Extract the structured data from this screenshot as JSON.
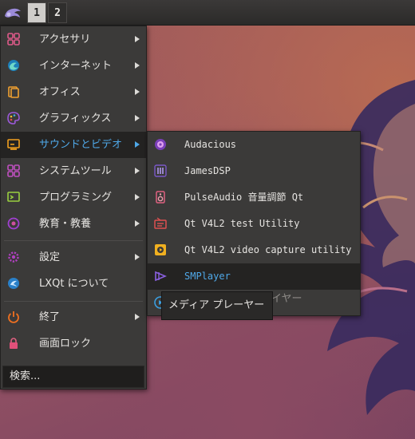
{
  "panel": {
    "desktops": [
      "1",
      "2"
    ],
    "active_desktop": "1"
  },
  "main_menu": {
    "items": [
      {
        "label": "アクセサリ",
        "icon": "accessories-icon",
        "submenu": true
      },
      {
        "label": "インターネット",
        "icon": "internet-icon",
        "submenu": true
      },
      {
        "label": "オフィス",
        "icon": "office-icon",
        "submenu": true
      },
      {
        "label": "グラフィックス",
        "icon": "graphics-icon",
        "submenu": true
      },
      {
        "label": "サウンドとビデオ",
        "icon": "sound-video-icon",
        "submenu": true,
        "selected": true
      },
      {
        "label": "システムツール",
        "icon": "system-tools-icon",
        "submenu": true
      },
      {
        "label": "プログラミング",
        "icon": "programming-icon",
        "submenu": true
      },
      {
        "label": "教育・教養",
        "icon": "education-icon",
        "submenu": true
      },
      {
        "label": "設定",
        "icon": "settings-icon",
        "submenu": true
      },
      {
        "label": "LXQt について",
        "icon": "lxqt-about-icon",
        "submenu": false
      },
      {
        "label": "終了",
        "icon": "power-icon",
        "submenu": true
      },
      {
        "label": "画面ロック",
        "icon": "lock-icon",
        "submenu": false
      }
    ],
    "search_label": "検索..."
  },
  "sound_video_menu": {
    "items": [
      {
        "label": "Audacious",
        "icon": "audacious-icon"
      },
      {
        "label": "JamesDSP",
        "icon": "jamesdsp-icon"
      },
      {
        "label": "PulseAudio 音量調節 Qt",
        "icon": "pulseaudio-icon"
      },
      {
        "label": "Qt V4L2 test Utility",
        "icon": "qv4l2-icon"
      },
      {
        "label": "Qt V4L2 video capture utility",
        "icon": "qvidcap-icon"
      },
      {
        "label": "SMPlayer",
        "icon": "smplayer-icon",
        "selected": true
      },
      {
        "label": "メディアプレイヤー",
        "icon": "mpv-icon",
        "partial_label": "mpv"
      }
    ]
  },
  "tooltip": {
    "text": "メディア プレーヤー"
  },
  "colors": {
    "highlight_text": "#4fa8e8",
    "menu_bg": "#3b3a39",
    "selected_bg": "#242322"
  }
}
